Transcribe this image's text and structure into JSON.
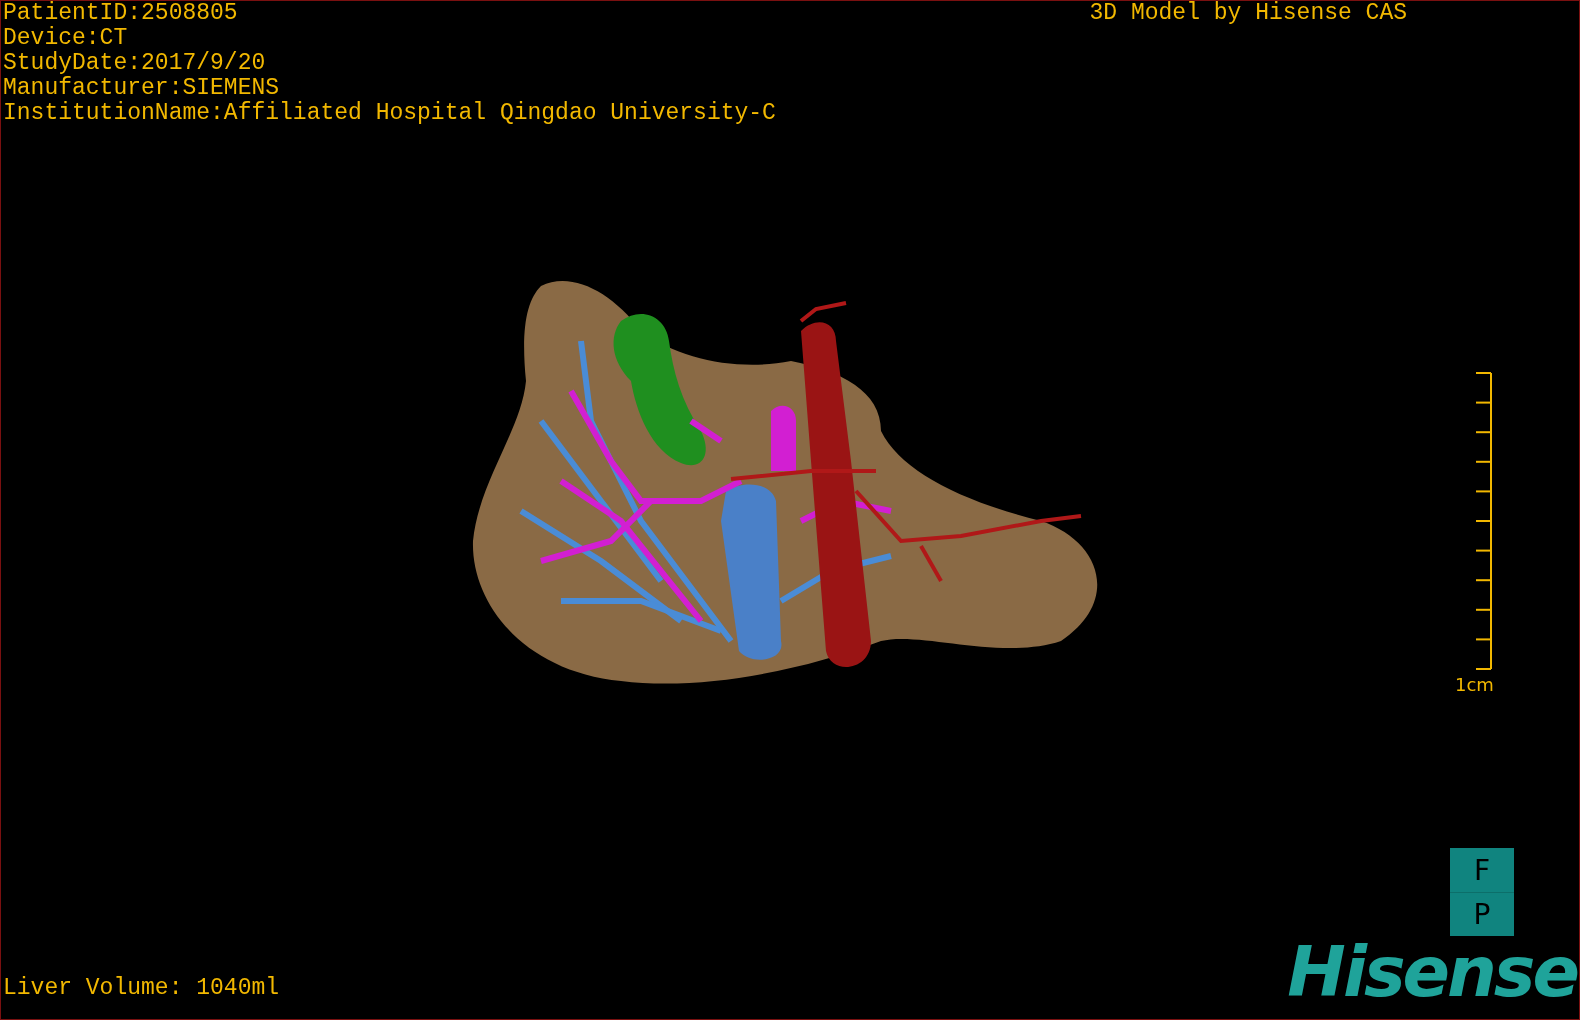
{
  "info_lines": [
    "PatientID:2508805",
    "Device:CT",
    "StudyDate:2017/9/20",
    "Manufacturer:SIEMENS",
    "InstitutionName:Affiliated Hospital Qingdao University-C"
  ],
  "title": "3D Model by Hisense CAS",
  "scale_bar": {
    "label": "1cm"
  },
  "liver_volume": "Liver Volume: 1040ml",
  "orientation_buttons": [
    "F",
    "P"
  ],
  "logo": "Hisense"
}
